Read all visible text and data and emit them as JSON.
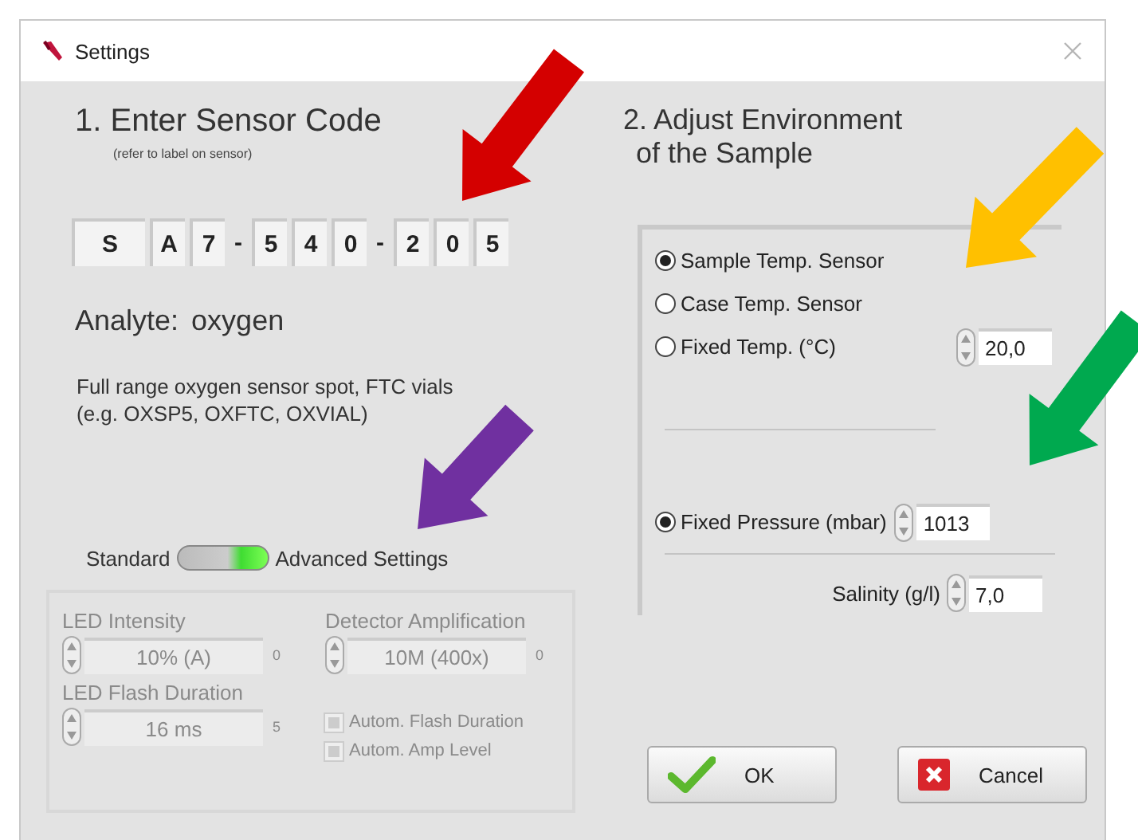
{
  "window": {
    "title": "Settings"
  },
  "sensor": {
    "heading": "1. Enter Sensor Code",
    "hint": "(refer to label on sensor)",
    "code": [
      {
        "kind": "box",
        "text": "S"
      },
      {
        "kind": "box",
        "text": "A"
      },
      {
        "kind": "box",
        "text": "7"
      },
      {
        "kind": "dash",
        "text": "-"
      },
      {
        "kind": "box",
        "text": "5"
      },
      {
        "kind": "box",
        "text": "4"
      },
      {
        "kind": "box",
        "text": "0"
      },
      {
        "kind": "dash",
        "text": "-"
      },
      {
        "kind": "box",
        "text": "2"
      },
      {
        "kind": "box",
        "text": "0"
      },
      {
        "kind": "box",
        "text": "5"
      }
    ],
    "analyte_label": "Analyte:",
    "analyte": "oxygen",
    "description": [
      "Full range oxygen sensor spot, FTC vials",
      "(e.g. OXSP5, OXFTC, OXVIAL)"
    ]
  },
  "mode": {
    "left_label": "Standard",
    "right_label": "Advanced Settings",
    "on": true
  },
  "advanced": {
    "disabled": true,
    "fields": [
      {
        "label": "LED Intensity",
        "value": "10% (A)",
        "suffix": "0"
      },
      {
        "label": "Detector Amplification",
        "value": "10M (400x)",
        "suffix": "0"
      },
      {
        "label": "LED Flash Duration",
        "value": "16 ms",
        "suffix": "5"
      }
    ],
    "checkboxes": [
      {
        "label": "Autom. Flash Duration",
        "checked": true
      },
      {
        "label": "Autom. Amp Level",
        "checked": true
      }
    ]
  },
  "environment": {
    "heading": [
      "2. Adjust Environment",
      "of the Sample"
    ],
    "temperature": [
      {
        "label": "Sample Temp. Sensor",
        "selected": true
      },
      {
        "label": "Case Temp. Sensor",
        "selected": false
      },
      {
        "label": "Fixed Temp. (°C)",
        "selected": false,
        "value": "20,0"
      }
    ],
    "pressure": {
      "label": "Fixed Pressure (mbar)",
      "selected": true,
      "value": "1013"
    },
    "salinity": {
      "label": "Salinity (g/l)",
      "value": "7,0"
    }
  },
  "buttons": [
    {
      "kind": "ok",
      "label": "OK"
    },
    {
      "kind": "cancel",
      "label": "Cancel"
    }
  ],
  "annotations": [
    {
      "color": "#d40000"
    },
    {
      "color": "#ffc000"
    },
    {
      "color": "#00a94f"
    },
    {
      "color": "#7030a0"
    }
  ]
}
